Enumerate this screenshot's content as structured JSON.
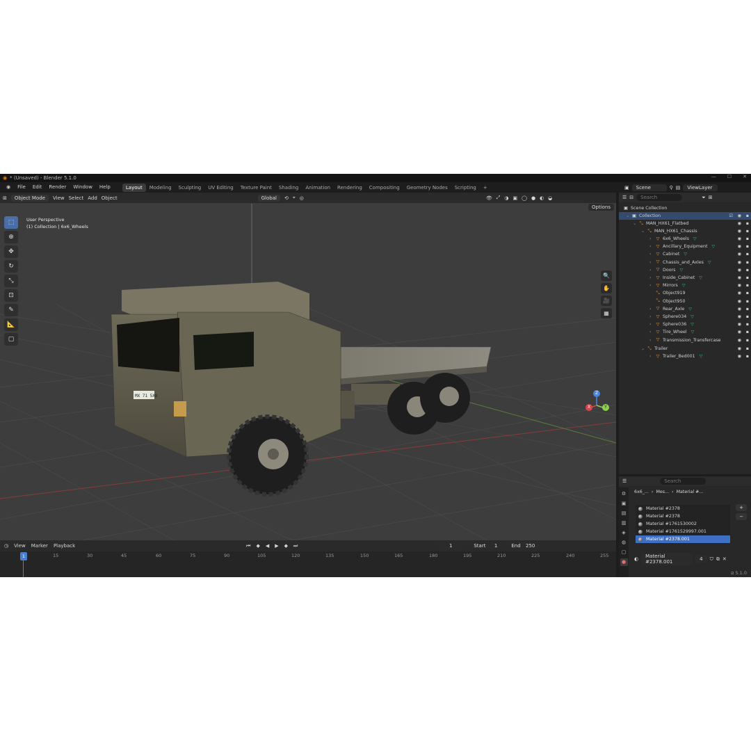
{
  "window": {
    "title": "* (Unsaved) - Blender 5.1.0"
  },
  "menu": {
    "file": "File",
    "edit": "Edit",
    "render": "Render",
    "window": "Window",
    "help": "Help"
  },
  "workspaces": [
    "Layout",
    "Modeling",
    "Sculpting",
    "UV Editing",
    "Texture Paint",
    "Shading",
    "Animation",
    "Rendering",
    "Compositing",
    "Geometry Nodes",
    "Scripting"
  ],
  "scene": {
    "scene_label": "Scene",
    "view_layer_label": "ViewLayer"
  },
  "viewport": {
    "mode": "Object Mode",
    "menus": {
      "view": "View",
      "select": "Select",
      "add": "Add",
      "object": "Object"
    },
    "orientation": "Global",
    "options": "Options",
    "info_line1": "User Perspective",
    "info_line2": "(1) Collection | 6x6_Wheels",
    "plate": "MX 71 5X8",
    "gizmo": {
      "x": "X",
      "y": "Y",
      "z": "Z"
    }
  },
  "timeline": {
    "menus": {
      "view": "View",
      "marker": "Marker",
      "playback": "Playback"
    },
    "current_frame": "1",
    "start_label": "Start",
    "start": "1",
    "end_label": "End",
    "end": "250",
    "ruler": [
      "15",
      "30",
      "45",
      "60",
      "75",
      "90",
      "105",
      "120",
      "135",
      "150",
      "165",
      "180",
      "195",
      "210",
      "225",
      "240",
      "255"
    ],
    "playhead": "1"
  },
  "outliner": {
    "search_placeholder": "Search",
    "scene_collection": "Scene Collection",
    "collection": "Collection",
    "flatbed": "MAN_HX61_Flatbed",
    "chassis": "MAN_HX61_Chassis",
    "children": [
      {
        "name": "6x6_Wheels",
        "mod": true,
        "selected": true
      },
      {
        "name": "Ancillary_Equipment",
        "mod": true
      },
      {
        "name": "Cabinet",
        "mod": true
      },
      {
        "name": "Chassis_and_Axles",
        "mod": true
      },
      {
        "name": "Doors",
        "mod": true
      },
      {
        "name": "Inside_Cabinet",
        "mod": true
      },
      {
        "name": "Mirrors",
        "mod": true
      },
      {
        "name": "Object919",
        "mod": false,
        "empty": true
      },
      {
        "name": "Object950",
        "mod": false,
        "empty": true
      },
      {
        "name": "Rear_Axle",
        "mod": true
      },
      {
        "name": "Sphere034",
        "mod": true
      },
      {
        "name": "Sphere036",
        "mod": true
      },
      {
        "name": "Tire_Wheel",
        "mod": true
      },
      {
        "name": "Transmission_Transfercase",
        "mod": false
      }
    ],
    "trailer": "Trailer",
    "trailer_bed": "Trailer_Bed001"
  },
  "properties": {
    "search_placeholder": "Search",
    "breadcrumb": {
      "object": "6x6_...",
      "mesh": "Mes...",
      "material": "Material #..."
    },
    "materials": [
      {
        "name": "Material #2378"
      },
      {
        "name": "Material #2378"
      },
      {
        "name": "Material #1761530002"
      },
      {
        "name": "Material #1761529997.001"
      },
      {
        "name": "Material #2378.001",
        "selected": true
      }
    ],
    "active_material": "Material #2378.001",
    "users": "4"
  },
  "status": {
    "version": "5.1.0"
  },
  "colors": {
    "accent": "#4a7fd0",
    "x_axis": "#d9434e",
    "y_axis": "#8bd14a",
    "z_axis": "#4a86e0",
    "selection": "#344b6e",
    "outliner_mesh": "#e9953a",
    "modifier": "#35c275"
  }
}
